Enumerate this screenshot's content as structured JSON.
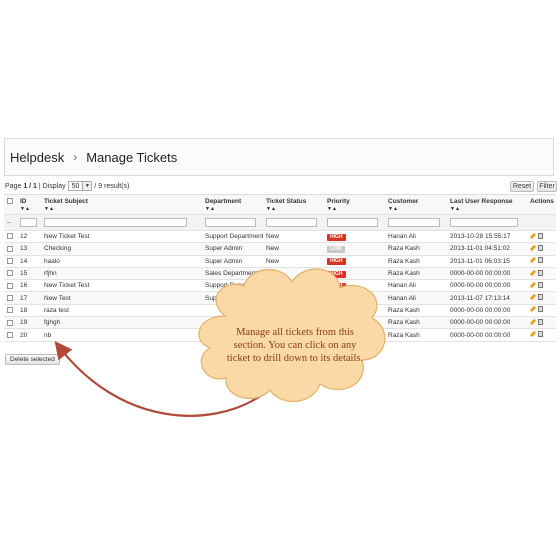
{
  "breadcrumb": {
    "root": "Helpdesk",
    "separator": "›",
    "current": "Manage Tickets"
  },
  "pager": {
    "page_label": "Page",
    "page_value": "1 / 1",
    "display_label": "| Display",
    "per_page": "50",
    "results": "/ 9 result(s)"
  },
  "buttons": {
    "reset": "Reset",
    "filter": "Filter",
    "delete_selected": "Delete selected"
  },
  "columns": [
    "ID",
    "Ticket Subject",
    "Department",
    "Ticket Status",
    "Priority",
    "Customer",
    "Last User Response",
    "Actions"
  ],
  "filter_row": {
    "marker": "--"
  },
  "rows": [
    {
      "id": "12",
      "subject": "New Ticket Test",
      "department": "Support Department",
      "status": "New",
      "priority": "HIGH",
      "priority_color": "#d9302a",
      "customer": "Hanan Ali",
      "last_response": "2013-10-28 15:55:17"
    },
    {
      "id": "13",
      "subject": "Checking",
      "department": "Super Admin",
      "status": "New",
      "priority": "LOW",
      "priority_color": "#c8c8c8",
      "customer": "Raza Kash",
      "last_response": "2013-11-01 04:51:02"
    },
    {
      "id": "14",
      "subject": "haalo",
      "department": "Super Admin",
      "status": "New",
      "priority": "HIGH",
      "priority_color": "#d9302a",
      "customer": "Raza Kash",
      "last_response": "2013-11-01 06:03:15"
    },
    {
      "id": "15",
      "subject": "rfjhn",
      "department": "Sales Department",
      "status": "Joke",
      "priority": "HIGH",
      "priority_color": "#d9302a",
      "customer": "Raza Kash",
      "last_response": "0000-00-00 00:00:00"
    },
    {
      "id": "16",
      "subject": "New Ticket Test",
      "department": "Support Department",
      "status": "New",
      "priority": "HIGH",
      "priority_color": "#d9302a",
      "customer": "Hanan Ali",
      "last_response": "0000-00-00 00:00:00"
    },
    {
      "id": "17",
      "subject": "New Test",
      "department": "Super Admin",
      "status": "",
      "priority": "HIGH",
      "priority_color": "#d9302a",
      "customer": "Hanan Ali",
      "last_response": "2013-11-07 17:13:14"
    },
    {
      "id": "18",
      "subject": "raza test",
      "department": "",
      "status": "",
      "priority": "",
      "priority_color": "#d9302a",
      "customer": "Raza Kash",
      "last_response": "0000-00-00 00:00:00"
    },
    {
      "id": "19",
      "subject": "fghgh",
      "department": "",
      "status": "",
      "priority": "",
      "priority_color": "#d9302a",
      "customer": "Raza Kash",
      "last_response": "0000-00-00 00:00:00"
    },
    {
      "id": "20",
      "subject": "nb",
      "department": "",
      "status": "",
      "priority": "",
      "priority_color": "#d9302a",
      "customer": "Raza Kash",
      "last_response": "0000-00-00 00:00:00"
    }
  ],
  "callout": {
    "text": "Manage all tickets from this section. You can click on any ticket to drill down to its details.",
    "fill_color": "#fbd9a6",
    "stroke_color": "#e3b06a",
    "arrow_color": "#b04a3a"
  }
}
